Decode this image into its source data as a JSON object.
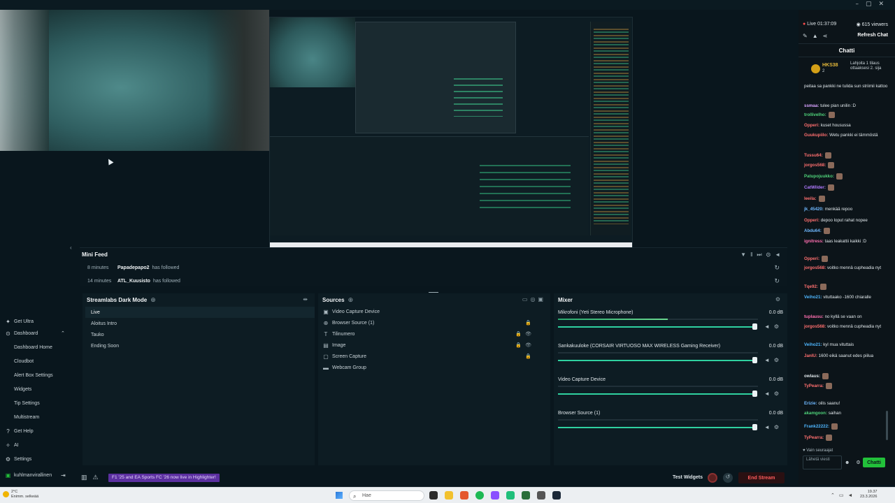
{
  "sidebar": {
    "items": [
      {
        "label": "Get Ultra",
        "icon": "ultra-icon"
      },
      {
        "label": "Dashboard",
        "icon": "dashboard-icon"
      },
      {
        "label": "Dashboard Home"
      },
      {
        "label": "Cloudbot"
      },
      {
        "label": "Alert Box Settings"
      },
      {
        "label": "Widgets"
      },
      {
        "label": "Tip Settings"
      },
      {
        "label": "Multistream"
      },
      {
        "label": "Get Help",
        "icon": "help-icon"
      },
      {
        "label": "AI",
        "icon": "ai-icon"
      },
      {
        "label": "Settings",
        "icon": "gear-icon"
      },
      {
        "label": "kuhlmanvirallinen",
        "icon": "user-icon"
      }
    ]
  },
  "minifeed": {
    "title": "Mini Feed",
    "rows": [
      {
        "time": "8 minutes",
        "user": "Papadepapo2",
        "action": "has followed"
      },
      {
        "time": "14 minutes",
        "user": "ATL_Kuusisto",
        "action": "has followed"
      }
    ]
  },
  "scenes": {
    "title": "Streamlabs Dark Mode",
    "items": [
      "Live",
      "Aloitus Intro",
      "Tauko",
      "Ending Soon"
    ]
  },
  "sources": {
    "title": "Sources",
    "items": [
      {
        "label": "Video Capture Device",
        "icon": "camera-icon"
      },
      {
        "label": "Browser Source (1)",
        "icon": "globe-icon"
      },
      {
        "label": "Tilinumero",
        "icon": "text-icon"
      },
      {
        "label": "Image",
        "icon": "image-icon"
      },
      {
        "label": "Screen Capture",
        "icon": "screen-icon"
      },
      {
        "label": "Webcam Group",
        "icon": "folder-icon"
      }
    ]
  },
  "mixer": {
    "title": "Mixer",
    "items": [
      {
        "name": "Mikrofoni (Yeti Stereo Microphone)",
        "db": "0.0 dB",
        "level": 0.55
      },
      {
        "name": "Sankakuuloke (CORSAIR VIRTUOSO MAX WIRELESS Gaming Receiver)",
        "db": "0.0 dB",
        "level": 0.0
      },
      {
        "name": "Video Capture Device",
        "db": "0.0 dB",
        "level": 0.0
      },
      {
        "name": "Browser Source (1)",
        "db": "0.0 dB",
        "level": 0.0
      }
    ]
  },
  "statusbar": {
    "notification": "F1 '25 and EA Sports FC '26 now live in Highlighter!",
    "test_widgets": "Test Widgets",
    "end_stream": "End Stream"
  },
  "chat": {
    "live_time": "Live 01:37:09",
    "viewers": "615 viewers",
    "refresh": "Refresh Chat",
    "header": "Chatti",
    "pinned": {
      "name": "HKS38",
      "num": "2",
      "text": "Lahjoita 1 tilaus ottaaksesi 2. sija"
    },
    "messages": [
      {
        "user": "",
        "text": "peitaa sa pankki ne tulida sun striimii kattoo",
        "color": "#dfe6ea"
      },
      {
        "user": "ssmaa:",
        "text": "tulee pian unilin :D",
        "color": "#d9a3ff"
      },
      {
        "user": "trollivelho:",
        "text": "",
        "color": "#4fd37a",
        "emote": true
      },
      {
        "user": "Opperi:",
        "text": "kuset housussa",
        "color": "#ff6f6f"
      },
      {
        "user": "Guukupiilo:",
        "text": "Wetu pankki ei tämmöstä",
        "color": "#ff6f6f"
      },
      {
        "user": "Tussu64:",
        "text": "",
        "color": "#ff6f6f",
        "emote": true
      },
      {
        "user": "jorgos568:",
        "text": "",
        "color": "#ff6f6f",
        "emote": true
      },
      {
        "user": "Patupojuukko:",
        "text": "",
        "color": "#4fd37a",
        "emote": true
      },
      {
        "user": "CatWilder:",
        "text": "",
        "color": "#b17aff",
        "emote": true
      },
      {
        "user": "leeila:",
        "text": "",
        "color": "#ff6f6f",
        "emote": true
      },
      {
        "user": "jk_45420:",
        "text": "menkää repoo",
        "color": "#6fb8ff"
      },
      {
        "user": "Opperi:",
        "text": "depoo loput rahat nopee",
        "color": "#ff6f6f"
      },
      {
        "user": "Abdu64:",
        "text": "",
        "color": "#6fb8ff",
        "emote": true
      },
      {
        "user": "ignitress:",
        "text": "taas leakattii kaikki :D",
        "color": "#ff6fb0"
      },
      {
        "user": "Opperi:",
        "text": "",
        "color": "#ff6f6f",
        "emote": true
      },
      {
        "user": "jorgos568:",
        "text": "voitko mennä cupheadia nyt",
        "color": "#ff6f6f"
      },
      {
        "user": "Tqe92:",
        "text": "",
        "color": "#ff6f6f",
        "emote": true
      },
      {
        "user": "Veiho21:",
        "text": "vituttaako -1600 chiaralle",
        "color": "#4fb7ff"
      },
      {
        "user": "tuplausu:",
        "text": "no kyllä se vaan on",
        "color": "#ff6fb0"
      },
      {
        "user": "jorgos568:",
        "text": "voitko mennä cupheadia nyt",
        "color": "#ff6f6f"
      },
      {
        "user": "Veiho21:",
        "text": "kyl mua vituttais",
        "color": "#4fb7ff"
      },
      {
        "user": "JanIU:",
        "text": "1600 eikä saanut edes piilua",
        "color": "#ff6f6f"
      },
      {
        "user": "owlaus:",
        "text": "",
        "color": "#dfe6ea",
        "emote": true
      },
      {
        "user": "TyPearra:",
        "text": "",
        "color": "#ff6f6f",
        "emote": true
      },
      {
        "user": "Erizie:",
        "text": "oilis saanu!",
        "color": "#6fb8ff"
      },
      {
        "user": "akamgoon:",
        "text": "saihan",
        "color": "#4fd37a"
      },
      {
        "user": "Frank22222:",
        "text": "",
        "color": "#4fb7ff",
        "emote": true
      },
      {
        "user": "TyPearra:",
        "text": "",
        "color": "#ff6f6f",
        "emote": true
      }
    ],
    "followers_only": "Vain seuraajat",
    "send_placeholder": "Lähetä viesti",
    "chat_button": "Chatti"
  },
  "taskbar": {
    "weather_temp": "2°C",
    "weather_desc": "Enimm. selkeää",
    "search": "Hae",
    "time": "19.37",
    "date": "23.3.2026"
  },
  "colors": {
    "accent": "#31c3a2",
    "end_stream": "#ff5b5b",
    "chat_button": "#22c13a",
    "notification": "#5b2fa0"
  }
}
